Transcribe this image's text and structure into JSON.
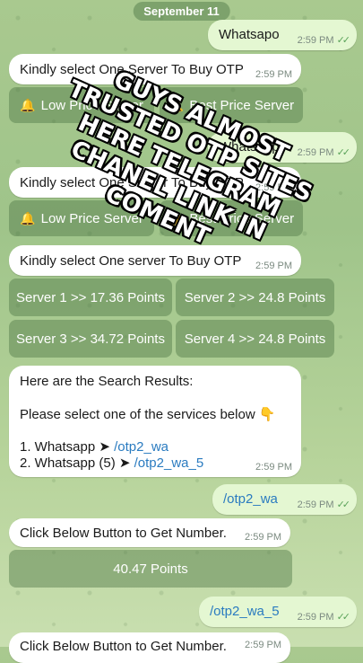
{
  "date_label": "September 11",
  "msgs": {
    "m1": {
      "text": "Whatsapo",
      "time": "2:59 PM"
    },
    "m2": {
      "text": "Kindly select One Server To Buy OTP",
      "time": "2:59 PM"
    },
    "k1": {
      "a": "Low Price Server",
      "b": "Best Price Server"
    },
    "m3": {
      "text": "Whatsapp",
      "time": "2:59 PM"
    },
    "m4": {
      "text": "Kindly select One Server To Buy OTP",
      "time": "2:59 PM"
    },
    "k2": {
      "a": "Low Price Server",
      "b": "Best Price Server"
    },
    "m5": {
      "text": "Kindly select One server To Buy OTP",
      "time": "2:59 PM"
    },
    "k3": {
      "s1": "Server 1 >> 17.36 Points",
      "s2": "Server 2 >> 24.8 Points",
      "s3": "Server 3 >> 34.72 Points",
      "s4": "Server 4 >> 24.8 Points"
    },
    "m6": {
      "line1": "Here are the Search Results:",
      "line2": "Please select one of the services below",
      "emoji": "👇",
      "item1_text": "1. Whatsapp ➤ ",
      "item1_link": "/otp2_wa",
      "item2_text": "2. Whatsapp (5) ➤ ",
      "item2_link": "/otp2_wa_5",
      "time": "2:59 PM"
    },
    "m7": {
      "text": "/otp2_wa",
      "time": "2:59 PM"
    },
    "m8": {
      "text": "Click Below Button to Get Number.",
      "time": "2:59 PM"
    },
    "k4": {
      "a": "40.47 Points"
    },
    "m9": {
      "text": "/otp2_wa_5",
      "time": "2:59 PM"
    },
    "m10": {
      "text": "Click Below Button to Get Number.",
      "time": "2:59 PM"
    }
  },
  "overlay": {
    "line1": "GUYS ALMOST",
    "line2": "TRUSTED OTP SITES",
    "line3": "HERE TELEGRAM",
    "line4": "CHANEL LINK IN",
    "line5": "COMENT"
  },
  "colors": {
    "outgoing": "#e4f7d2",
    "link": "#2a7bc0",
    "check": "#5ba35a"
  }
}
